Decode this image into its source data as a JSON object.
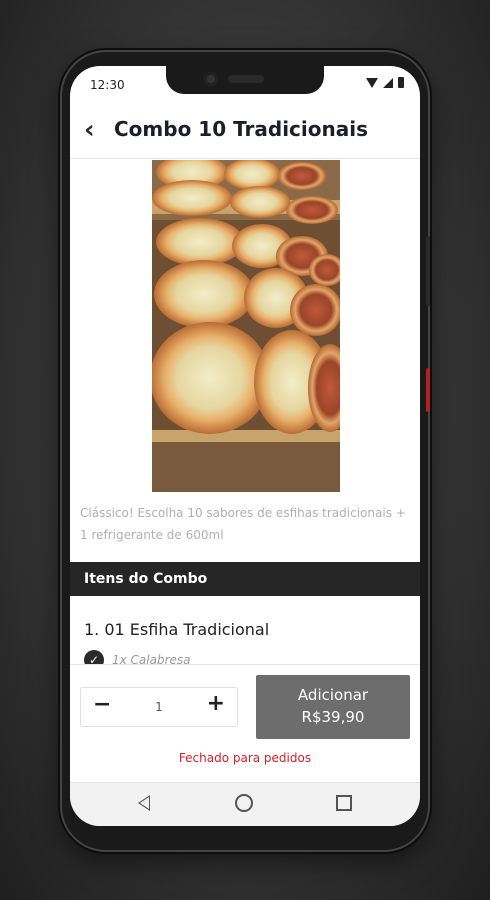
{
  "status_bar": {
    "time": "12:30"
  },
  "header": {
    "title": "Combo 10 Tradicionais"
  },
  "product": {
    "image_alt": "esfihas",
    "description": "Clássico! Escolha 10 sabores de esfihas tradicionais + 1 refrigerante de 600ml"
  },
  "section": {
    "title": "Itens do Combo"
  },
  "items": [
    {
      "title": "1. 01 Esfiha Tradicional",
      "option": "1x Calabresa"
    }
  ],
  "order": {
    "quantity": "1",
    "add_label": "Adicionar",
    "price": "R$39,90",
    "status_message": "Fechado para pedidos"
  },
  "colors": {
    "closed": "#d3202a",
    "button": "#6d6d6d",
    "section_bg": "#262626"
  },
  "icons": [
    "back-arrow-icon",
    "wifi-icon",
    "signal-icon",
    "battery-icon",
    "check-circle-icon",
    "minus-icon",
    "plus-icon",
    "nav-back-icon",
    "nav-home-icon",
    "nav-recents-icon"
  ]
}
